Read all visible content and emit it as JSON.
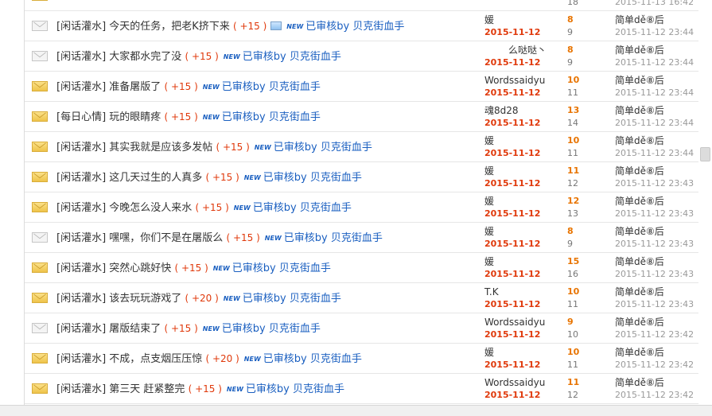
{
  "top_row": {
    "views": "18",
    "last_time": "2015-11-13 16:42"
  },
  "labels": {
    "new_tag": "NEW"
  },
  "rows": [
    {
      "category": "[闲话灌水]",
      "subject": "今天的任务，把老K挤下来",
      "points": "( +15 )",
      "has_image": true,
      "review": "已审核by 贝克街血手",
      "author": "媛",
      "date": "2015-11-12",
      "replies": "8",
      "views": "9",
      "last_user": "简单dě⑧后",
      "last_time": "2015-11-12 23:44",
      "icon": "read"
    },
    {
      "category": "[闲话灌水]",
      "subject": "大家都水完了没",
      "points": "( +15 )",
      "has_image": false,
      "review": "已审核by 贝克街血手",
      "author": "么哒哒丶",
      "date": "2015-11-12",
      "replies": "8",
      "views": "9",
      "last_user": "简单dě⑧后",
      "last_time": "2015-11-12 23:44",
      "icon": "read"
    },
    {
      "category": "[闲话灌水]",
      "subject": "准备屠版了",
      "points": "( +15 )",
      "has_image": false,
      "review": "已审核by 贝克街血手",
      "author": "Wordssaidyu",
      "date": "2015-11-12",
      "replies": "10",
      "views": "11",
      "last_user": "简单dě⑧后",
      "last_time": "2015-11-12 23:44",
      "icon": "new"
    },
    {
      "category": "[每日心情]",
      "subject": "玩的眼睛疼",
      "points": "( +15 )",
      "has_image": false,
      "review": "已审核by 贝克街血手",
      "author": "魂8d28",
      "date": "2015-11-12",
      "replies": "13",
      "views": "14",
      "last_user": "简单dě⑧后",
      "last_time": "2015-11-12 23:44",
      "icon": "new"
    },
    {
      "category": "[闲话灌水]",
      "subject": "其实我就是应该多发帖",
      "points": "( +15 )",
      "has_image": false,
      "review": "已审核by 贝克街血手",
      "author": "媛",
      "date": "2015-11-12",
      "replies": "10",
      "views": "11",
      "last_user": "简单dě⑧后",
      "last_time": "2015-11-12 23:44",
      "icon": "new"
    },
    {
      "category": "[闲话灌水]",
      "subject": "这几天过生的人真多",
      "points": "( +15 )",
      "has_image": false,
      "review": "已审核by 贝克街血手",
      "author": "媛",
      "date": "2015-11-12",
      "replies": "11",
      "views": "12",
      "last_user": "简单dě⑧后",
      "last_time": "2015-11-12 23:43",
      "icon": "new"
    },
    {
      "category": "[闲话灌水]",
      "subject": "今晚怎么没人来水",
      "points": "( +15 )",
      "has_image": false,
      "review": "已审核by 贝克街血手",
      "author": "媛",
      "date": "2015-11-12",
      "replies": "12",
      "views": "13",
      "last_user": "简单dě⑧后",
      "last_time": "2015-11-12 23:43",
      "icon": "new"
    },
    {
      "category": "[闲话灌水]",
      "subject": "嘿嘿，你们不是在屠版么",
      "points": "( +15 )",
      "has_image": false,
      "review": "已审核by 贝克街血手",
      "author": "媛",
      "date": "2015-11-12",
      "replies": "8",
      "views": "9",
      "last_user": "简单dě⑧后",
      "last_time": "2015-11-12 23:43",
      "icon": "read"
    },
    {
      "category": "[闲话灌水]",
      "subject": "突然心跳好快",
      "points": "( +15 )",
      "has_image": false,
      "review": "已审核by 贝克街血手",
      "author": "媛",
      "date": "2015-11-12",
      "replies": "15",
      "views": "16",
      "last_user": "简单dě⑧后",
      "last_time": "2015-11-12 23:43",
      "icon": "new"
    },
    {
      "category": "[闲话灌水]",
      "subject": "该去玩玩游戏了",
      "points": "( +20 )",
      "has_image": false,
      "review": "已审核by 贝克街血手",
      "author": "T.K",
      "date": "2015-11-12",
      "replies": "10",
      "views": "11",
      "last_user": "简单dě⑧后",
      "last_time": "2015-11-12 23:43",
      "icon": "new"
    },
    {
      "category": "[闲话灌水]",
      "subject": "屠版结束了",
      "points": "( +15 )",
      "has_image": false,
      "review": "已审核by 贝克街血手",
      "author": "Wordssaidyu",
      "date": "2015-11-12",
      "replies": "9",
      "views": "10",
      "last_user": "简单dě⑧后",
      "last_time": "2015-11-12 23:42",
      "icon": "read"
    },
    {
      "category": "[闲话灌水]",
      "subject": "不成，点支烟压压惊",
      "points": "( +20 )",
      "has_image": false,
      "review": "已审核by 贝克街血手",
      "author": "媛",
      "date": "2015-11-12",
      "replies": "10",
      "views": "11",
      "last_user": "简单dě⑧后",
      "last_time": "2015-11-12 23:42",
      "icon": "new"
    },
    {
      "category": "[闲话灌水]",
      "subject": "第三天 赶紧整完",
      "points": "( +15 )",
      "has_image": false,
      "review": "已审核by 贝克街血手",
      "author": "Wordssaidyu",
      "date": "2015-11-12",
      "replies": "11",
      "views": "12",
      "last_user": "简单dě⑧后",
      "last_time": "2015-11-12 23:42",
      "icon": "new"
    }
  ]
}
